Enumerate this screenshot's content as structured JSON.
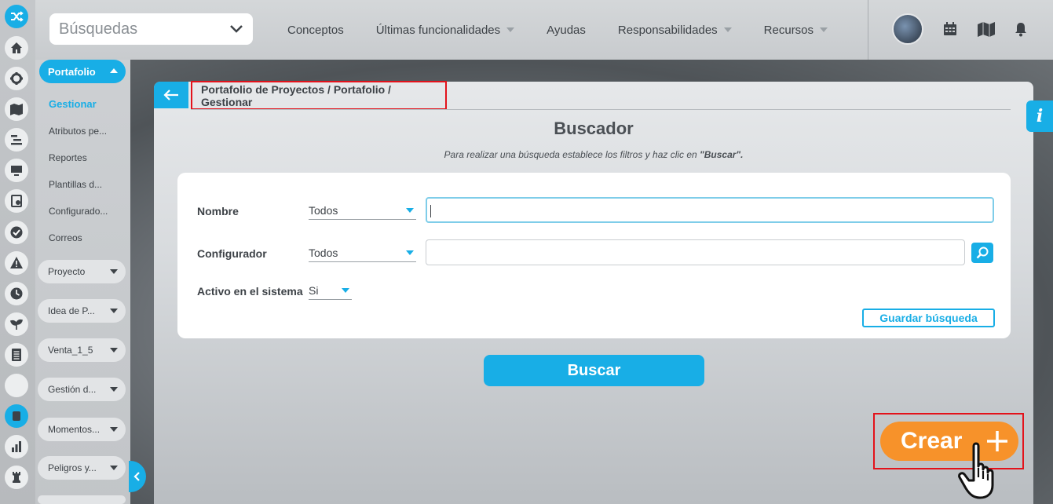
{
  "topbar": {
    "search_select": "Búsquedas",
    "nav": [
      {
        "label": "Conceptos",
        "has_caret": false
      },
      {
        "label": "Últimas funcionalidades",
        "has_caret": true
      },
      {
        "label": "Ayudas",
        "has_caret": false
      },
      {
        "label": "Responsabilidades",
        "has_caret": true
      },
      {
        "label": "Recursos",
        "has_caret": true
      }
    ],
    "icons": [
      "avatar",
      "calendar-icon",
      "map-icon",
      "bell-icon"
    ]
  },
  "rail": {
    "icons": [
      "shuffle-icon",
      "home-icon",
      "gear-icon",
      "map-icon",
      "gantt-icon",
      "monitor-icon",
      "checklist-icon",
      "check-circle-icon",
      "warning-icon",
      "clock-icon",
      "sprout-icon",
      "document-icon",
      "blank-icon",
      "portfolio-icon",
      "bar-chart-icon",
      "chess-rook-icon"
    ],
    "active": "portfolio-icon"
  },
  "submenu": {
    "active_group": "Portafolio",
    "links": [
      "Gestionar",
      "Atributos pe...",
      "Reportes",
      "Plantillas d...",
      "Configurado...",
      "Correos"
    ],
    "current_link": "Gestionar",
    "groups": [
      "Proyecto",
      "Idea de P...",
      "Venta_1_5",
      "Gestión d...",
      "Momentos...",
      "Peligros y..."
    ]
  },
  "breadcrumb": "Portafolio de Proyectos / Portafolio / Gestionar",
  "page": {
    "title": "Buscador",
    "subtitle_pre": "Para realizar una búsqueda establece los filtros y haz clic en ",
    "subtitle_bold": "\"Buscar\".",
    "form": {
      "nombre_label": "Nombre",
      "nombre_option": "Todos",
      "nombre_value": "",
      "configurador_label": "Configurador",
      "configurador_option": "Todos",
      "configurador_value": "",
      "activo_label": "Activo en el sistema",
      "activo_option": "Si",
      "save_label": "Guardar búsqueda"
    },
    "search_button": "Buscar",
    "create_button": "Crear"
  },
  "colors": {
    "accent": "#18aee6",
    "create": "#f7922a",
    "highlight": "#e3121b"
  }
}
